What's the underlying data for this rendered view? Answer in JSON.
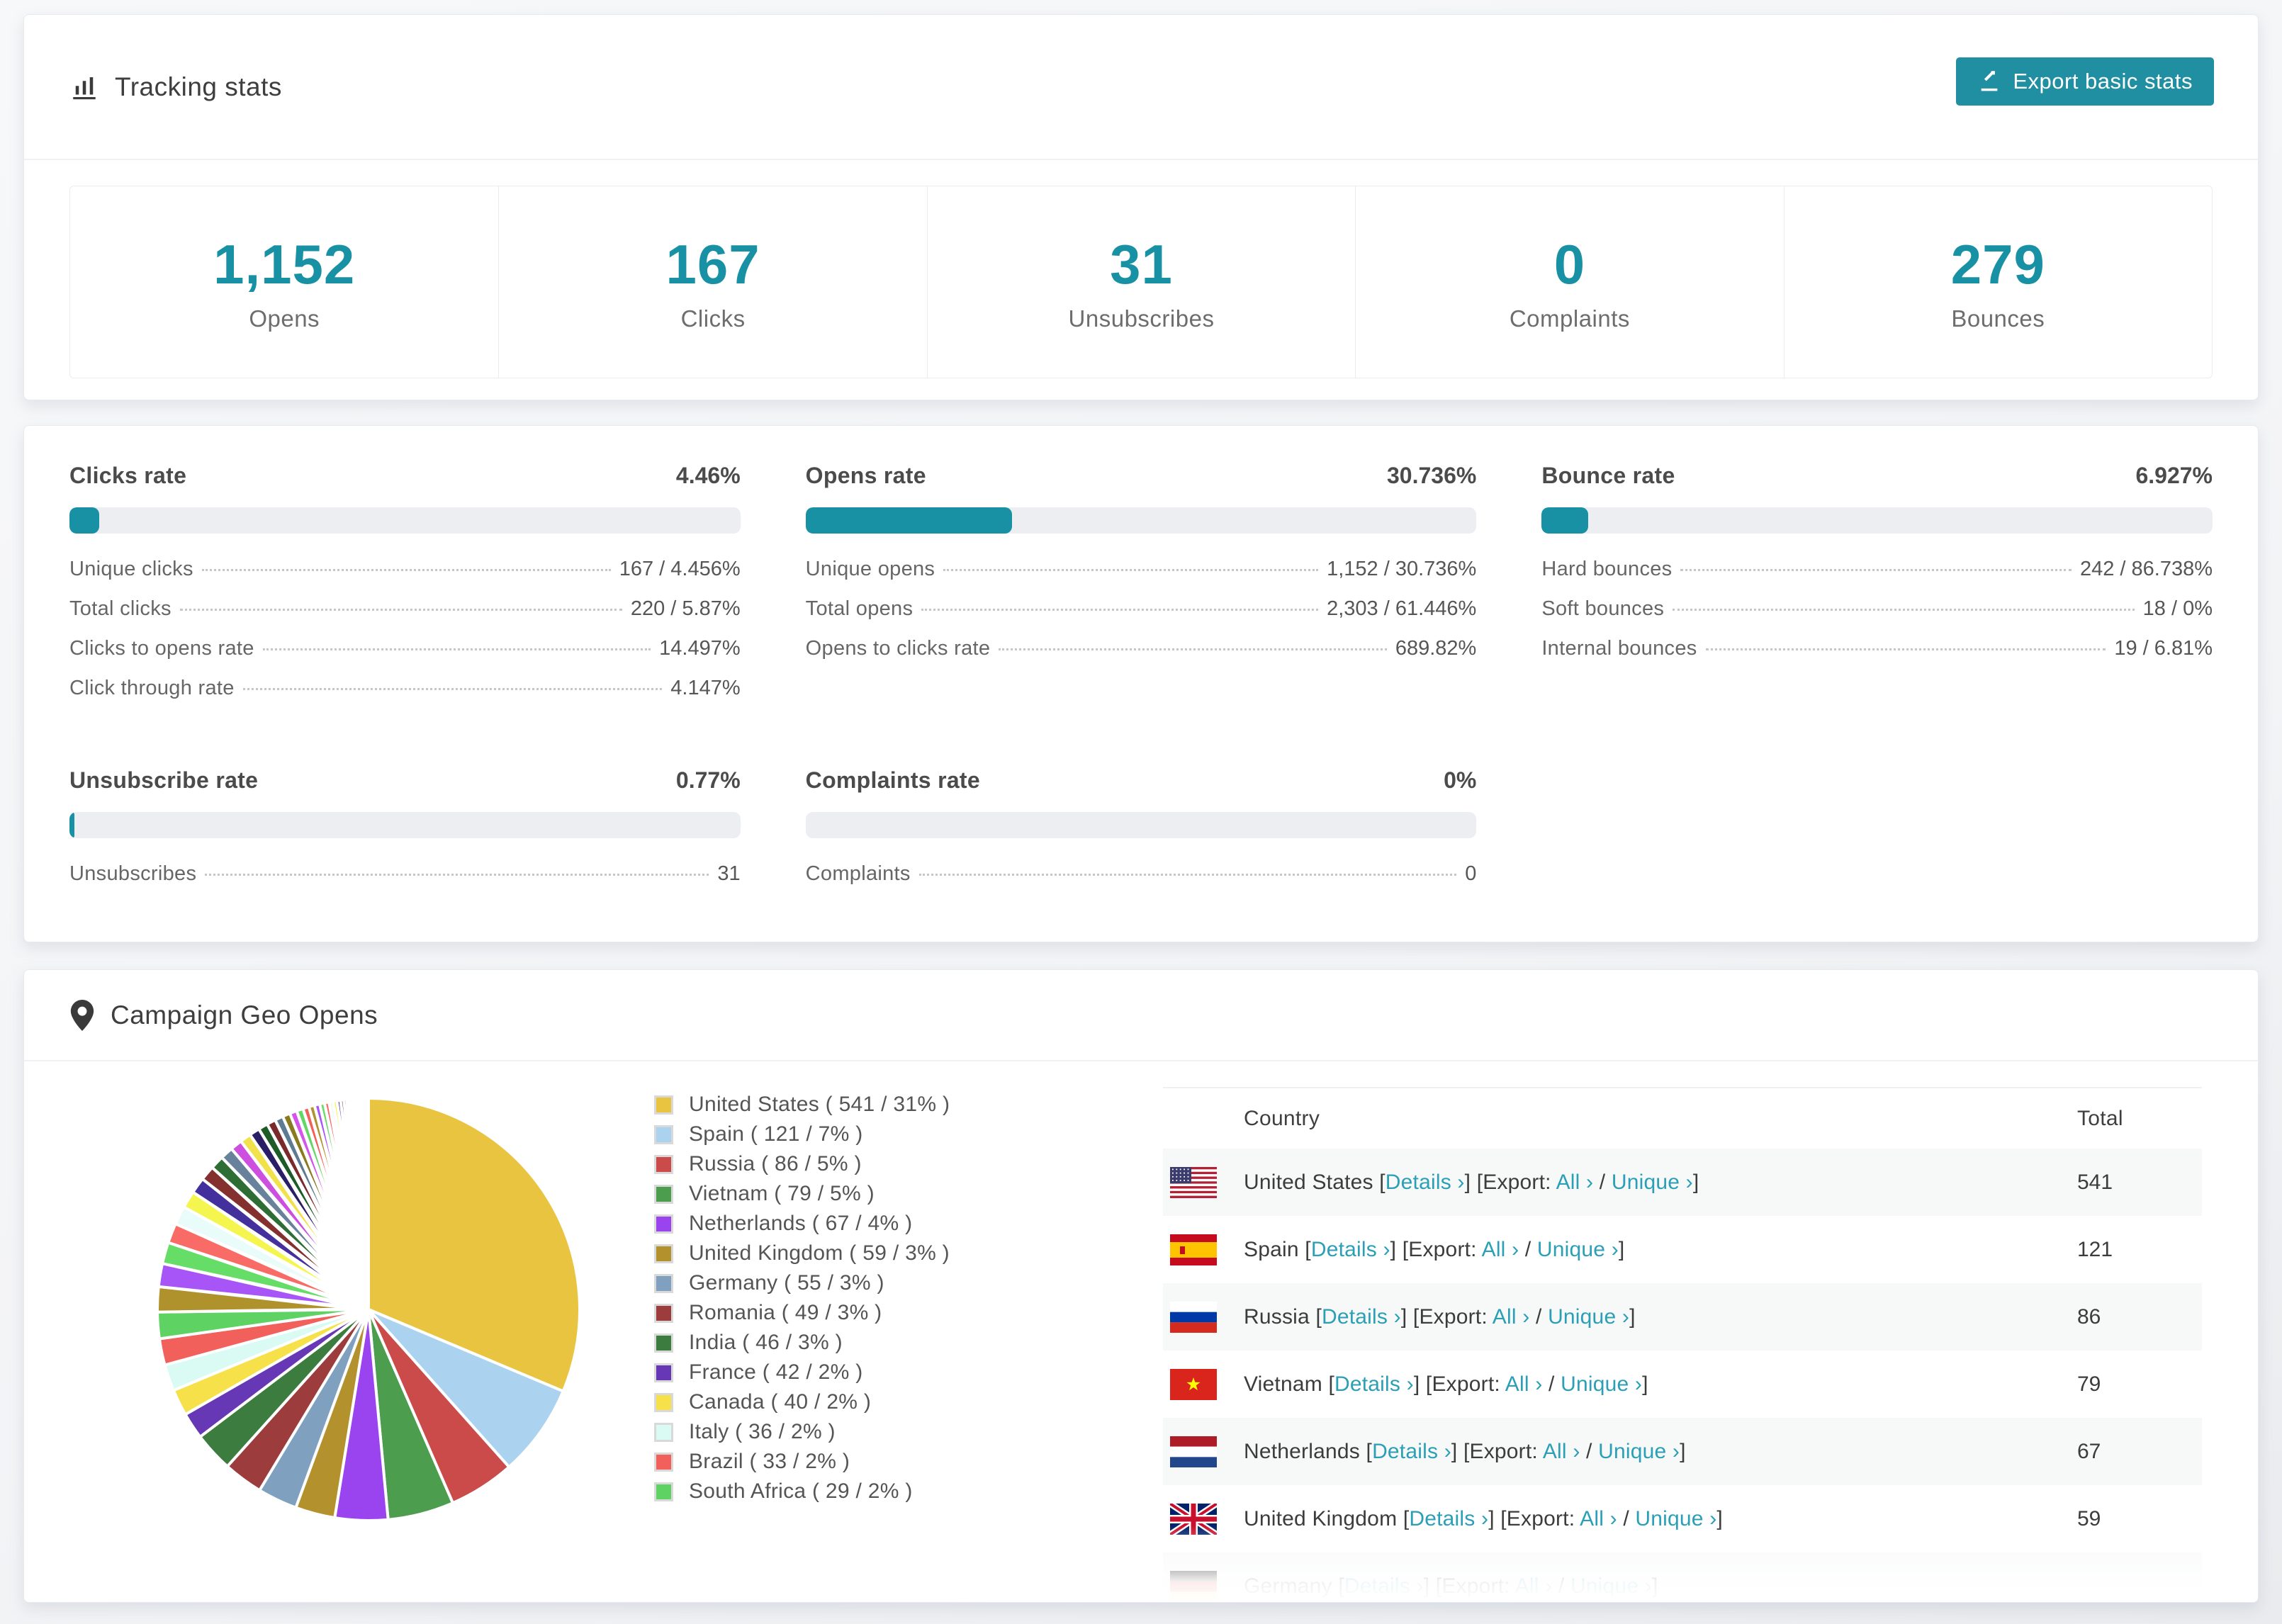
{
  "accent_color": "#1791a3",
  "link_color": "#2a9fb6",
  "tracking": {
    "title": "Tracking stats",
    "export_label": "Export basic stats",
    "stats": [
      {
        "value": "1,152",
        "label": "Opens"
      },
      {
        "value": "167",
        "label": "Clicks"
      },
      {
        "value": "31",
        "label": "Unsubscribes"
      },
      {
        "value": "0",
        "label": "Complaints"
      },
      {
        "value": "279",
        "label": "Bounces"
      }
    ]
  },
  "rates": [
    {
      "title": "Clicks rate",
      "value": "4.46%",
      "percent": 4.46,
      "rows": [
        {
          "label": "Unique clicks",
          "value": "167 / 4.456%"
        },
        {
          "label": "Total clicks",
          "value": "220 / 5.87%"
        },
        {
          "label": "Clicks to opens rate",
          "value": "14.497%"
        },
        {
          "label": "Click through rate",
          "value": "4.147%"
        }
      ]
    },
    {
      "title": "Opens rate",
      "value": "30.736%",
      "percent": 30.736,
      "rows": [
        {
          "label": "Unique opens",
          "value": "1,152 / 30.736%"
        },
        {
          "label": "Total opens",
          "value": "2,303 / 61.446%"
        },
        {
          "label": "Opens to clicks rate",
          "value": "689.82%"
        }
      ]
    },
    {
      "title": "Bounce rate",
      "value": "6.927%",
      "percent": 6.927,
      "rows": [
        {
          "label": "Hard bounces",
          "value": "242 / 86.738%"
        },
        {
          "label": "Soft bounces",
          "value": "18 / 0%"
        },
        {
          "label": "Internal bounces",
          "value": "19 / 6.81%"
        }
      ]
    },
    {
      "title": "Unsubscribe rate",
      "value": "0.77%",
      "percent": 0.77,
      "rows": [
        {
          "label": "Unsubscribes",
          "value": "31"
        }
      ]
    },
    {
      "title": "Complaints rate",
      "value": "0%",
      "percent": 0,
      "rows": [
        {
          "label": "Complaints",
          "value": "0"
        }
      ]
    }
  ],
  "geo": {
    "title": "Campaign Geo Opens",
    "table": {
      "columns": [
        "Country",
        "Total"
      ],
      "details_label": "Details ›",
      "export_label": "Export:",
      "all_label": "All ›",
      "unique_label": "Unique ›",
      "rows": [
        {
          "country": "United States",
          "total": "541",
          "flag": "us"
        },
        {
          "country": "Spain",
          "total": "121",
          "flag": "es"
        },
        {
          "country": "Russia",
          "total": "86",
          "flag": "ru"
        },
        {
          "country": "Vietnam",
          "total": "79",
          "flag": "vn"
        },
        {
          "country": "Netherlands",
          "total": "67",
          "flag": "nl"
        },
        {
          "country": "United Kingdom",
          "total": "59",
          "flag": "gb"
        },
        {
          "country": "Germany",
          "total": "",
          "flag": "de"
        }
      ]
    }
  },
  "chart_data": {
    "type": "pie",
    "title": "Campaign Geo Opens",
    "legend_position": "right",
    "start_angle_deg": 0,
    "direction": "clockwise",
    "slices": [
      {
        "label": "United States",
        "value": 541,
        "percent": 31,
        "color": "#e9c441",
        "legend": "United States ( 541 / 31% )"
      },
      {
        "label": "Spain",
        "value": 121,
        "percent": 7,
        "color": "#abd3f0",
        "legend": "Spain ( 121 / 7% )"
      },
      {
        "label": "Russia",
        "value": 86,
        "percent": 5,
        "color": "#cb4a4a",
        "legend": "Russia ( 86 / 5% )"
      },
      {
        "label": "Vietnam",
        "value": 79,
        "percent": 5,
        "color": "#4d9d4f",
        "legend": "Vietnam ( 79 / 5% )"
      },
      {
        "label": "Netherlands",
        "value": 67,
        "percent": 4,
        "color": "#9a44ef",
        "legend": "Netherlands ( 67 / 4% )"
      },
      {
        "label": "United Kingdom",
        "value": 59,
        "percent": 3,
        "color": "#b3922e",
        "legend": "United Kingdom ( 59 / 3% )"
      },
      {
        "label": "Germany",
        "value": 55,
        "percent": 3,
        "color": "#7fa0bf",
        "legend": "Germany ( 55 / 3% )"
      },
      {
        "label": "Romania",
        "value": 49,
        "percent": 3,
        "color": "#9d3c3c",
        "legend": "Romania ( 49 / 3% )"
      },
      {
        "label": "India",
        "value": 46,
        "percent": 3,
        "color": "#3c7c3e",
        "legend": "India ( 46 / 3% )"
      },
      {
        "label": "France",
        "value": 42,
        "percent": 2,
        "color": "#6738b5",
        "legend": "France ( 42 / 2% )"
      },
      {
        "label": "Canada",
        "value": 40,
        "percent": 2,
        "color": "#f6e14b",
        "legend": "Canada ( 40 / 2% )"
      },
      {
        "label": "Italy",
        "value": 36,
        "percent": 2,
        "color": "#dafbf3",
        "legend": "Italy ( 36 / 2% )"
      },
      {
        "label": "Brazil",
        "value": 33,
        "percent": 2,
        "color": "#f2605c",
        "legend": "Brazil ( 33 / 2% )"
      },
      {
        "label": "South Africa",
        "value": 29,
        "percent": 2,
        "color": "#5ed364",
        "legend": "South Africa ( 29 / 2% )"
      }
    ],
    "others_percents": [
      1.9,
      1.75,
      1.62,
      1.5,
      1.4,
      1.3,
      1.21,
      1.12,
      1.04,
      0.97,
      0.9,
      0.84,
      0.78,
      0.72,
      0.67,
      0.62,
      0.58,
      0.54,
      0.5,
      0.46,
      0.43,
      0.4,
      0.37,
      0.34,
      0.31,
      0.29,
      0.27,
      0.25,
      0.23,
      0.21,
      0.19,
      0.17,
      0.155,
      0.14,
      0.125,
      0.11,
      0.1,
      0.09,
      0.08,
      0.07,
      0.06,
      0.05,
      0.04,
      0.03
    ],
    "others_colors": [
      "#b0922c",
      "#a855f7",
      "#66dd66",
      "#f96b66",
      "#e9fcf9",
      "#f5f54f",
      "#43309c",
      "#84302e",
      "#2e6d33",
      "#69829c",
      "#cc4fe0",
      "#f1e24c",
      "#2a1f66",
      "#1d5b29",
      "#7a2a2a",
      "#5d7b93",
      "#8a7a1e",
      "#d455ec",
      "#64d664",
      "#f2605c"
    ]
  }
}
